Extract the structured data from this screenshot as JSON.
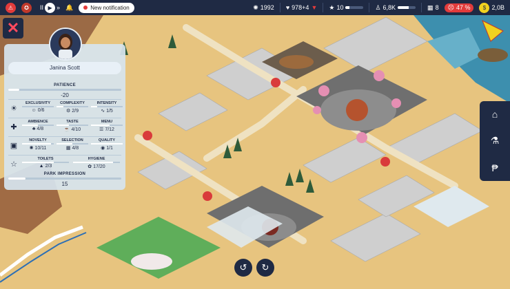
{
  "topbar": {
    "speed_pause": "II",
    "speed_play": "▶",
    "speed_fast": "»",
    "notification": "New notification",
    "guests_total": "1992",
    "rating_stat": "978+4",
    "rating_arrow": "▼",
    "star_count": "10",
    "staff_value": "6,8K",
    "calendar_value": "8",
    "happiness_percent": "47 %",
    "happiness_level": 0.47,
    "money": "2,0B"
  },
  "guest": {
    "name": "Janina Scott",
    "patience": {
      "label": "PATIENCE",
      "value": "-20",
      "level": 0.1
    },
    "groups": [
      {
        "icon": "ride-icon",
        "stats": [
          {
            "label": "EXCLUSIVITY",
            "value": "0/6",
            "icon": "☺",
            "level": 0.0
          },
          {
            "label": "COMPLEXITY",
            "value": "2/9",
            "icon": "⚙",
            "level": 0.22
          },
          {
            "label": "INTENSITY",
            "value": "1/5",
            "icon": "∿",
            "level": 0.2
          }
        ]
      },
      {
        "icon": "food-icon",
        "stats": [
          {
            "label": "AMBIENCE",
            "value": "4/8",
            "icon": "♣",
            "level": 0.5
          },
          {
            "label": "TASTE",
            "value": "4/10",
            "icon": "☕",
            "level": 0.4
          },
          {
            "label": "MENU",
            "value": "7/12",
            "icon": "☰",
            "level": 0.58
          }
        ]
      },
      {
        "icon": "shop-icon",
        "stats": [
          {
            "label": "NOVELTY",
            "value": "10/11",
            "icon": "✺",
            "level": 0.91
          },
          {
            "label": "SELECTION",
            "value": "4/8",
            "icon": "▦",
            "level": 0.5
          },
          {
            "label": "QUALITY",
            "value": "1/1",
            "icon": "◉",
            "level": 1.0
          }
        ]
      },
      {
        "icon": "star-icon",
        "stats": [
          {
            "label": "TOILETS",
            "value": "2/3",
            "icon": "▲",
            "level": 0.67
          },
          {
            "label": "HYGIENE",
            "value": "17/20",
            "icon": "✿",
            "level": 0.85
          }
        ]
      }
    ],
    "park_impression": {
      "label": "PARK IMPRESSION",
      "value": "15",
      "level": 0.15
    }
  },
  "dock": {
    "items": [
      "build-icon",
      "research-icon",
      "finance-icon"
    ]
  },
  "colors": {
    "ui_dark": "#1f2a44",
    "alert": "#e23b3b",
    "sand": "#e6c27d"
  }
}
